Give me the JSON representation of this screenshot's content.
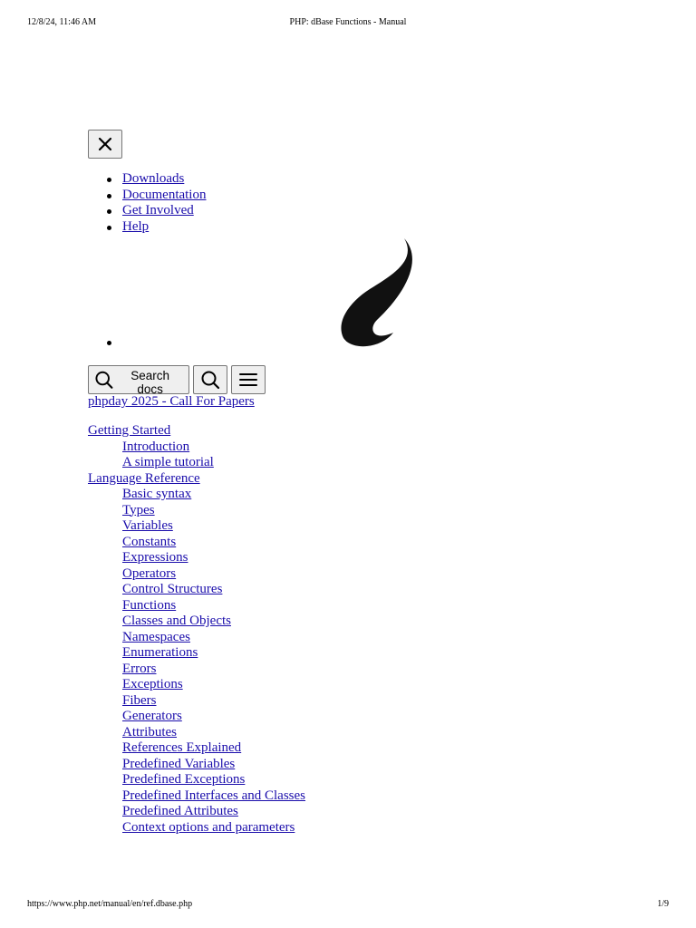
{
  "print_header": {
    "datetime": "12/8/24, 11:46 AM",
    "title": "PHP: dBase Functions - Manual"
  },
  "print_footer": {
    "url": "https://www.php.net/manual/en/ref.dbase.php",
    "page": "1/9"
  },
  "icons": {
    "close": "close-icon",
    "search": "search-icon",
    "menu": "hamburger-menu-icon",
    "logo": "php-elephant-logo"
  },
  "nav": {
    "items": [
      "Downloads",
      "Documentation",
      "Get Involved",
      "Help"
    ]
  },
  "search": {
    "label": "Search docs"
  },
  "promo": {
    "label": "phpday 2025 - Call For Papers"
  },
  "toc": {
    "getting_started": {
      "label": "Getting Started",
      "items": [
        "Introduction",
        "A simple tutorial"
      ]
    },
    "language_reference": {
      "label": "Language Reference",
      "items": [
        "Basic syntax",
        "Types",
        "Variables",
        "Constants",
        "Expressions",
        "Operators",
        "Control Structures",
        "Functions",
        "Classes and Objects",
        "Namespaces",
        "Enumerations",
        "Errors",
        "Exceptions",
        "Fibers",
        "Generators",
        "Attributes",
        "References Explained",
        "Predefined Variables",
        "Predefined Exceptions",
        "Predefined Interfaces and Classes",
        "Predefined Attributes",
        "Context options and parameters"
      ]
    }
  }
}
